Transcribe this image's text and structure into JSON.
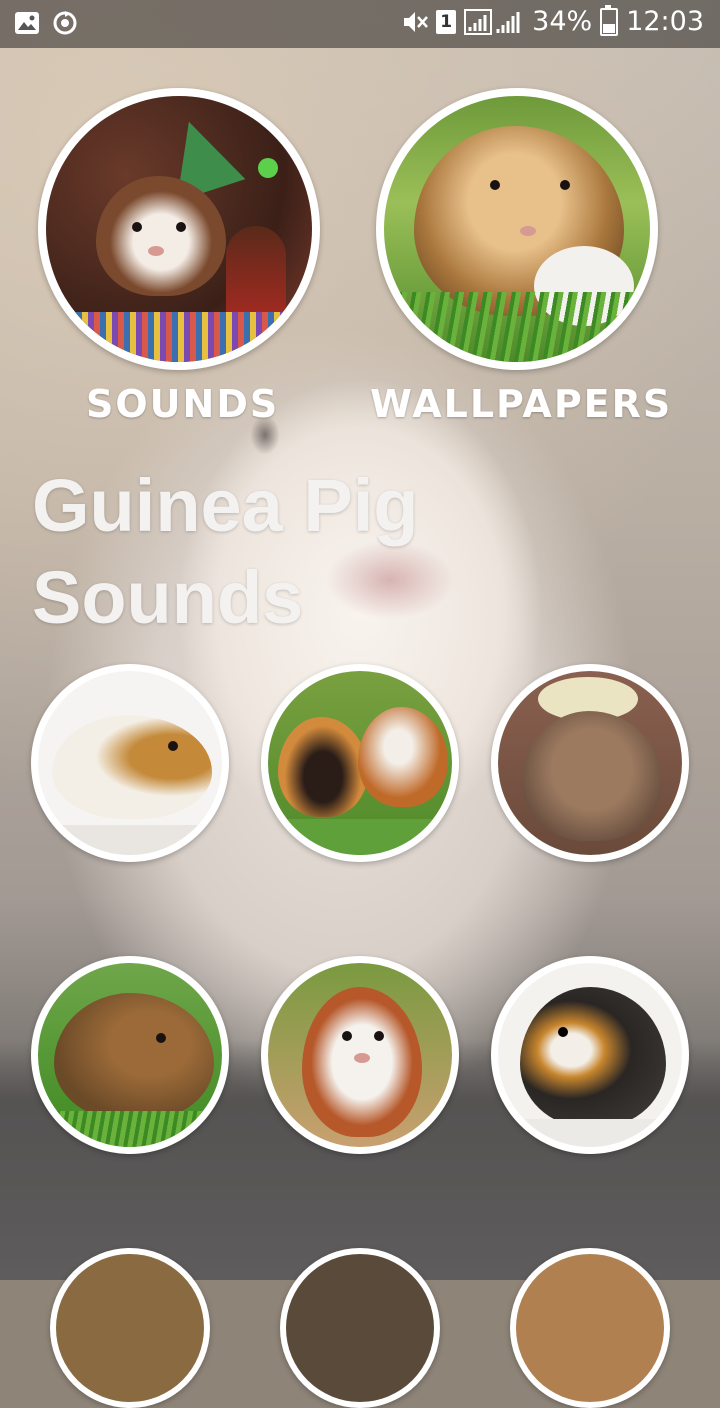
{
  "status_bar": {
    "gallery_icon": "image-icon",
    "sync_icon": "sync-icon",
    "mute_icon": "mute-icon",
    "sim": "1",
    "signal_icon": "signal-icon",
    "battery": "34%",
    "battery_level": 0.34,
    "time": "12:03"
  },
  "menu": {
    "sounds_label": "SOUNDS",
    "wallpapers_label": "WALLPAPERS"
  },
  "title": "Guinea Pig Sounds",
  "tiles": [
    {
      "subject": "white-brown guinea pig on white fur"
    },
    {
      "subject": "two guinea pigs eating greens"
    },
    {
      "subject": "brown guinea pig with leaves"
    },
    {
      "subject": "brown guinea pig in grass"
    },
    {
      "subject": "white and red guinea pig"
    },
    {
      "subject": "black tricolor guinea pig"
    }
  ],
  "colors": {
    "caption": "#ffffff",
    "title": "#f4f2f0",
    "circle_border": "#ffffff"
  }
}
